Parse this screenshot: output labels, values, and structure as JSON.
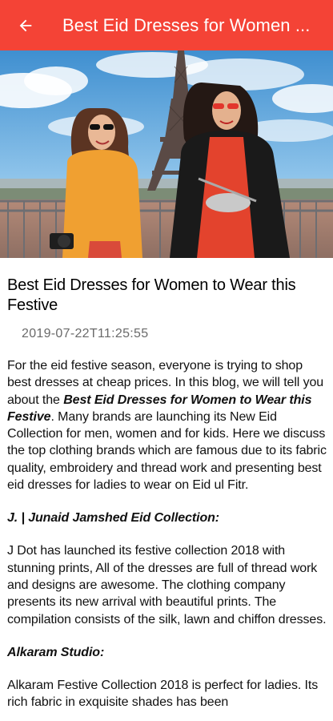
{
  "colors": {
    "app_bar": "#f44336",
    "app_bar_text": "#ffffff",
    "body_text": "#111111",
    "date_text": "#6a6a6a"
  },
  "app_bar": {
    "back_icon": "arrow-left-icon",
    "title": "Best Eid Dresses for Women ..."
  },
  "hero": {
    "image_alt": "Two women laughing in front of the Eiffel Tower"
  },
  "article": {
    "title": "Best Eid Dresses for Women to Wear this Festive",
    "date": "2019-07-22T11:25:55",
    "intro_before": "For the eid festive season, everyone is trying to shop best dresses at cheap prices. In this blog, we will tell you about the ",
    "intro_emphasis": "Best Eid Dresses for Women to Wear this Festive",
    "intro_after": ". Many brands are launching its New Eid Collection for men, women and for kids. Here we discuss the top clothing brands which are famous due to its fabric quality, embroidery and thread work and presenting best eid dresses for ladies to wear on Eid ul Fitr.",
    "section1_heading": "J. | Junaid Jamshed Eid Collection:",
    "section1_body": "J Dot has launched its festive collection 2018 with stunning prints, All of the dresses are full of thread work and designs are awesome. The clothing company presents its new arrival with beautiful prints. The compilation consists of the silk, lawn and chiffon dresses.",
    "section2_heading": "Alkaram Studio:",
    "section2_body": "Alkaram Festive Collection 2018 is perfect for ladies. Its rich fabric in exquisite shades has been"
  }
}
